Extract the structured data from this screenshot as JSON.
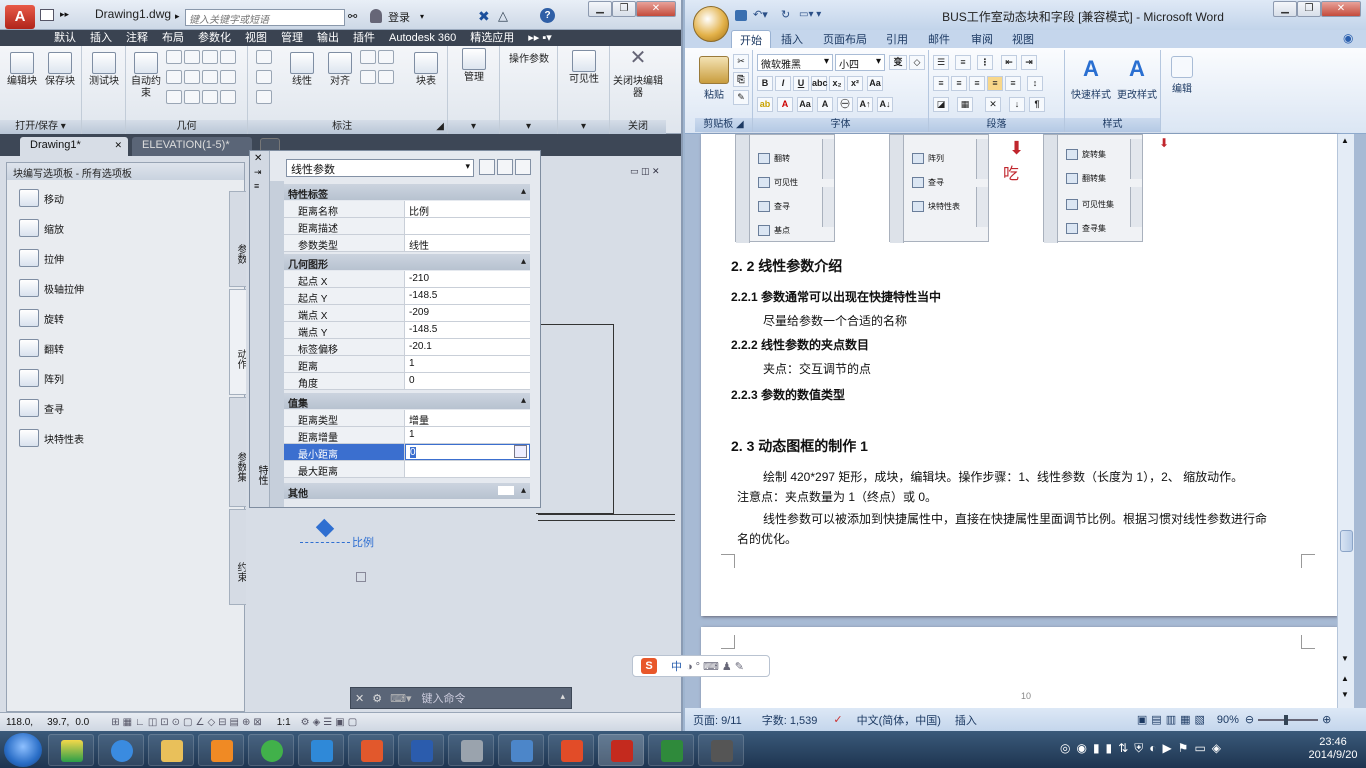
{
  "cad": {
    "title": "Drawing1.dwg",
    "search_placeholder": "键入关键字或短语",
    "login": "登录",
    "menu": [
      "默认",
      "插入",
      "注释",
      "布局",
      "参数化",
      "视图",
      "管理",
      "输出",
      "插件",
      "Autodesk 360",
      "精选应用"
    ],
    "ribbon_groups": [
      {
        "title": "打开/保存",
        "buttons": [
          "编辑块",
          "保存块"
        ]
      },
      {
        "title": "",
        "buttons": [
          "测试块"
        ]
      },
      {
        "title": "几何",
        "buttons": [
          "自动约束"
        ]
      },
      {
        "title": "标注",
        "buttons": [
          "线性",
          "对齐",
          "块表"
        ]
      },
      {
        "title": "",
        "buttons": [
          "管理"
        ]
      },
      {
        "title": "",
        "buttons": [
          "操作参数"
        ]
      },
      {
        "title": "",
        "buttons": [
          "可见性"
        ]
      },
      {
        "title": "关闭",
        "buttons": [
          "关闭块编辑器"
        ]
      }
    ],
    "doc_tabs": [
      "Drawing1*",
      "ELEVATION(1-5)*"
    ],
    "palette": {
      "title": "块编写选项板 - 所有选项板",
      "items": [
        "移动",
        "缩放",
        "拉伸",
        "极轴拉伸",
        "旋转",
        "翻转",
        "阵列",
        "查寻",
        "块特性表"
      ],
      "vtabs": [
        "参数",
        "动作",
        "参数集",
        "约束"
      ]
    },
    "properties": {
      "strip_label": "特性",
      "selector": "线性参数",
      "sections": [
        {
          "title": "特性标签",
          "rows": [
            [
              "距离名称",
              "比例"
            ],
            [
              "距离描述",
              ""
            ],
            [
              "参数类型",
              "线性"
            ]
          ]
        },
        {
          "title": "几何图形",
          "rows": [
            [
              "起点 X",
              "-210"
            ],
            [
              "起点 Y",
              "-148.5"
            ],
            [
              "端点 X",
              "-209"
            ],
            [
              "端点 Y",
              "-148.5"
            ],
            [
              "标签偏移",
              "-20.1"
            ],
            [
              "距离",
              "1"
            ],
            [
              "角度",
              "0"
            ]
          ]
        },
        {
          "title": "值集",
          "rows": [
            [
              "距离类型",
              "增量"
            ],
            [
              "距离增量",
              "1"
            ],
            [
              "最小距离",
              "0"
            ],
            [
              "最大距离",
              ""
            ]
          ]
        },
        {
          "title": "其他",
          "rows": []
        }
      ],
      "selected_row": "最小距离"
    },
    "canvas_label": "比例",
    "command_placeholder": "键入命令",
    "status": {
      "x": "118.0",
      "y": "39.7",
      "z": "0.0",
      "scale": "1:1"
    }
  },
  "word": {
    "title": "BUS工作室动态块和字段 [兼容模式] - Microsoft Word",
    "tabs": [
      "开始",
      "插入",
      "页面布局",
      "引用",
      "邮件",
      "审阅",
      "视图"
    ],
    "font_name": "微软雅黑",
    "font_size": "小四",
    "groups": [
      "剪贴板",
      "字体",
      "段落",
      "样式"
    ],
    "buttons": {
      "paste": "粘贴",
      "quick_styles": "快速样式",
      "change_styles": "更改样式",
      "edit": "编辑"
    },
    "thumb_images": [
      {
        "items": [
          "翻转",
          "可见性",
          "查寻",
          "基点"
        ]
      },
      {
        "items": [
          "阵列",
          "查寻",
          "块特性表"
        ],
        "note": "吃"
      },
      {
        "items": [
          "旋转集",
          "翻转集",
          "可见性集",
          "查寻集"
        ]
      }
    ],
    "doc": {
      "h_2_2": "2. 2 线性参数介绍",
      "h_2_2_1": "2.2.1 参数通常可以出现在快捷特性当中",
      "p_2_2_1": "尽量给参数一个合适的名称",
      "h_2_2_2": "2.2.2 线性参数的夹点数目",
      "p_2_2_2": "夹点：交互调节的点",
      "h_2_2_3": "2.2.3 参数的数值类型",
      "h_2_3": "2. 3 动态图框的制作 1",
      "p_2_3_a": "绘制 420*297 矩形，成块，编辑块。操作步骤：1、线性参数（长度为 1），2、 缩放动作。",
      "p_2_3_b": "注意点：夹点数量为 1（终点）或 0。",
      "p_2_3_c": "线性参数可以被添加到快捷属性中，直接在快捷属性里面调节比例。根据习惯对线性参数进行命",
      "p_2_3_d": "名的优化。",
      "page2_num": "10"
    },
    "status": {
      "page": "页面: 9/11",
      "words": "字数: 1,539",
      "lang": "中文(简体，中国)",
      "mode": "插入",
      "zoom": "90%"
    }
  },
  "ime": {
    "label": "中"
  },
  "taskbar": {
    "time": "23:46",
    "date": "2014/9/20"
  }
}
